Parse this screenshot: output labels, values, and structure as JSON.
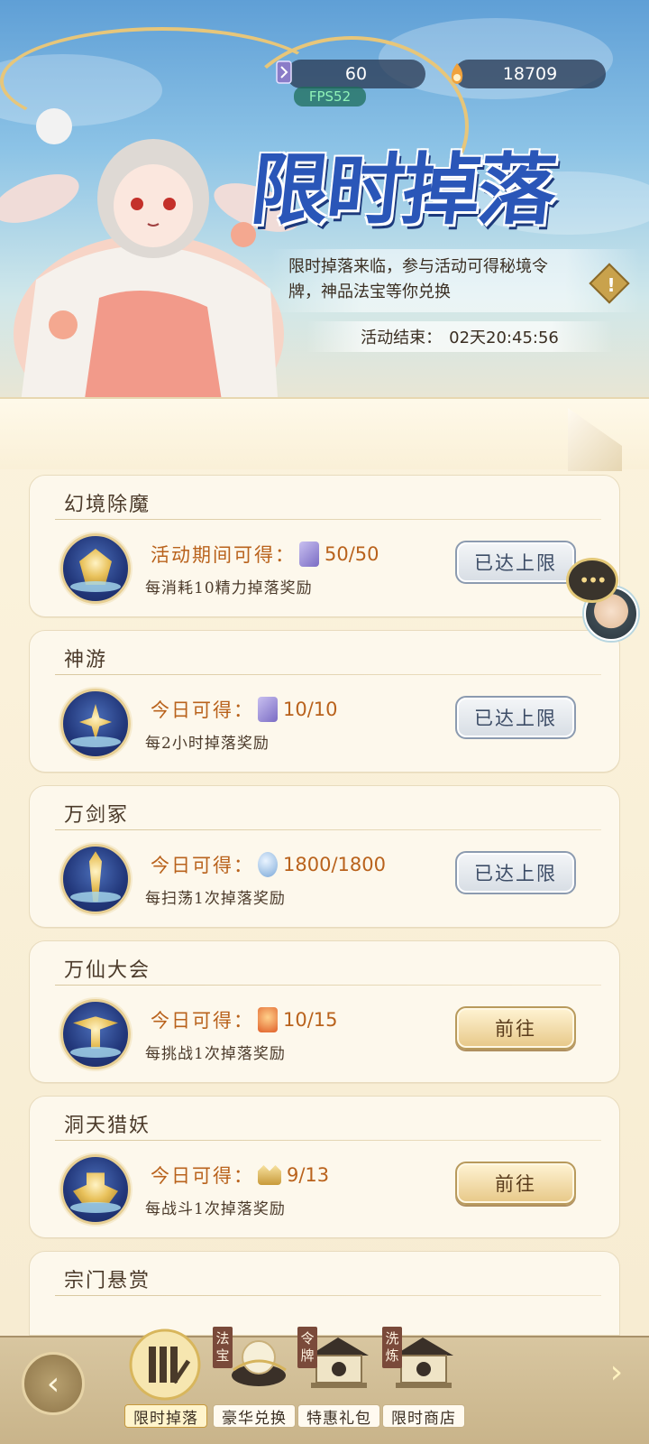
{
  "header": {
    "resources": [
      {
        "icon": "token-icon",
        "value": "60",
        "color": "#8a7cc8"
      },
      {
        "icon": "spirit-flame-icon",
        "value": "18709",
        "color": "#f0a23c"
      }
    ],
    "fps": "FPS52"
  },
  "banner": {
    "title": "限时掉落",
    "description": "限时掉落来临，参与活动可得秘境令牌，神品法宝等你兑换",
    "end_label": "活动结束：",
    "end_value": "02天20:45:56"
  },
  "activities": [
    {
      "title": "幻境除魔",
      "avail_label": "活动期间可得：",
      "item_icon": "secret-token-icon",
      "count": "50/50",
      "sub": "每消耗10精力掉落奖励",
      "button": "已达上限",
      "state": "maxed",
      "icon": "demon-mask-icon"
    },
    {
      "title": "神游",
      "avail_label": "今日可得：",
      "item_icon": "secret-token-icon",
      "count": "10/10",
      "sub": "每2小时掉落奖励",
      "button": "已达上限",
      "state": "maxed",
      "icon": "golden-sun-icon"
    },
    {
      "title": "万剑冢",
      "avail_label": "今日可得：",
      "item_icon": "crystal-egg-icon",
      "count": "1800/1800",
      "sub": "每扫荡1次掉落奖励",
      "button": "已达上限",
      "state": "maxed",
      "icon": "sword-icon"
    },
    {
      "title": "万仙大会",
      "avail_label": "今日可得：",
      "item_icon": "fire-beast-icon",
      "count": "10/15",
      "sub": "每挑战1次掉落奖励",
      "button": "前往",
      "state": "go",
      "icon": "crossed-halberds-icon"
    },
    {
      "title": "洞天猎妖",
      "avail_label": "今日可得：",
      "item_icon": "golden-crown-icon",
      "count": "9/13",
      "sub": "每战斗1次掉落奖励",
      "button": "前往",
      "state": "go",
      "icon": "golden-ship-icon"
    },
    {
      "title": "宗门悬赏"
    }
  ],
  "bottom_nav": [
    {
      "label": "限时掉落",
      "active": true,
      "icon": "talisman-icon"
    },
    {
      "label": "豪华兑换",
      "tag": [
        "法",
        "宝"
      ],
      "icon": "treasure-bowl-icon"
    },
    {
      "label": "特惠礼包",
      "tag": [
        "令",
        "牌"
      ],
      "icon": "pavilion-icon"
    },
    {
      "label": "限时商店",
      "tag": [
        "洗",
        "炼"
      ],
      "icon": "pavilion-icon"
    }
  ],
  "colors": {
    "title_blue": "#2a56b8",
    "accent_orange": "#b9621c",
    "panel_bg": "#fbf3dd"
  }
}
